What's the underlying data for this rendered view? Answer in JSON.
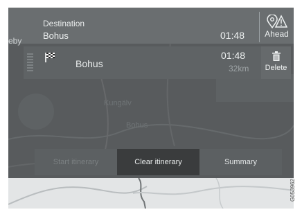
{
  "header": {
    "destination_label": "Destination",
    "destination_name": "Bohus",
    "arrival_time": "01:48",
    "ahead_label": "Ahead",
    "ahead_icon": "pin-warning-icon"
  },
  "map_labels": {
    "left_edge": "eby",
    "kungalv": "Kungälv",
    "bohus": "Bohus"
  },
  "itinerary": [
    {
      "icon": "checkered-flag-icon",
      "name": "Bohus",
      "time": "01:48",
      "distance": "32km",
      "delete_label": "Delete",
      "delete_icon": "trash-icon"
    }
  ],
  "tabs": [
    {
      "label": "Start itinerary",
      "state": "disabled"
    },
    {
      "label": "Clear itinerary",
      "state": "active"
    },
    {
      "label": "Summary",
      "state": "normal"
    }
  ],
  "figure_code": "G053962"
}
